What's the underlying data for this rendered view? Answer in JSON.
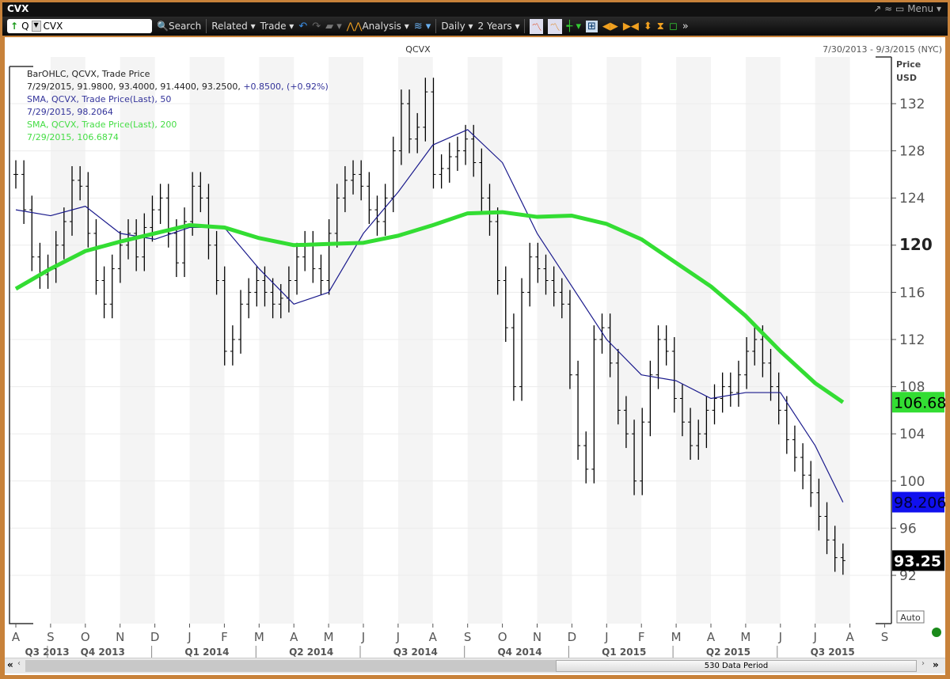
{
  "window": {
    "title": "CVX",
    "menu_label": "Menu ▾"
  },
  "toolbar": {
    "symbol_prefix": "Q",
    "symbol_value": "CVX",
    "search": "Search",
    "related": "Related ▾",
    "trade": "Trade ▾",
    "analysis": "Analysis ▾",
    "interval": "Daily ▾",
    "range": "2 Years ▾"
  },
  "chart_header": {
    "symbol": "QCVX",
    "date_range": "7/30/2013 - 9/3/2015 (NYC)",
    "axis_title_1": "Price",
    "axis_title_2": "USD",
    "auto_label": "Auto"
  },
  "legend": {
    "line1": "BarOHLC, QCVX, Trade Price",
    "line2_values": "7/29/2015, 91.9800, 93.4000, 91.4400, 93.2500, ",
    "line2_change": "+0.8500, (+0.92%)",
    "line3": "SMA, QCVX, Trade Price(Last),  50",
    "line4": "7/29/2015, 98.2064",
    "line5": "SMA, QCVX, Trade Price(Last),  200",
    "line6": "7/29/2015, 106.6874"
  },
  "scrollbar": {
    "label": "530 Data Period"
  },
  "colors": {
    "sma50": "#1a1a8c",
    "sma200": "#33dd33",
    "bars": "#000000",
    "frame": "#c8823a"
  },
  "chart_data": {
    "type": "ohlc",
    "title": "QCVX",
    "ylabel": "Price USD",
    "ylim": [
      88,
      136
    ],
    "yticks": [
      92,
      96,
      100,
      104,
      108,
      112,
      116,
      120,
      124,
      128,
      132
    ],
    "months": [
      "A",
      "S",
      "O",
      "N",
      "D",
      "J",
      "F",
      "M",
      "A",
      "M",
      "J",
      "J",
      "A",
      "S",
      "O",
      "N",
      "D",
      "J",
      "F",
      "M",
      "A",
      "M",
      "J",
      "J",
      "A",
      "S"
    ],
    "quarters": [
      "Q3 2013",
      "Q4 2013",
      "Q1 2014",
      "Q2 2014",
      "Q3 2014",
      "Q4 2014",
      "Q1 2015",
      "Q2 2015",
      "Q3 2015"
    ],
    "price_weekly_close_approx": [
      126,
      123,
      119,
      117.5,
      118,
      120,
      122,
      125.5,
      125,
      121,
      117,
      115,
      118,
      120,
      121,
      119,
      121.5,
      123,
      124,
      121,
      118.5,
      122,
      125,
      124,
      120,
      117,
      111,
      112,
      115,
      116,
      117,
      116,
      115,
      115.5,
      117,
      119,
      120,
      118,
      117,
      121,
      124,
      125.5,
      126,
      125,
      123,
      122,
      124,
      128,
      132,
      129,
      130,
      133,
      126,
      126.5,
      127.5,
      128,
      129,
      127,
      124,
      122,
      117,
      113,
      108,
      116,
      119,
      118,
      117,
      116,
      115,
      109,
      103,
      101,
      112,
      113,
      110,
      106,
      104,
      100,
      105,
      109,
      112,
      111,
      107,
      105,
      103,
      104,
      106,
      107,
      108,
      107.5,
      109,
      111,
      112,
      110,
      108,
      106,
      103.5,
      102,
      100.5,
      99,
      97,
      95,
      93.5,
      93.25
    ],
    "series": [
      {
        "name": "SMA 50",
        "values": [
          123,
          122.5,
          123.3,
          121,
          120.5,
          121.5,
          121.5,
          118,
          115,
          116,
          121,
          124.5,
          128.5,
          129.8,
          127,
          121,
          116.5,
          112,
          109,
          108.5,
          107,
          107.5,
          107.5,
          103,
          98.2
        ]
      },
      {
        "name": "SMA 200",
        "values": [
          116.3,
          118,
          119.5,
          120.3,
          121,
          121.7,
          121.5,
          120.6,
          120,
          120.1,
          120.2,
          120.8,
          121.7,
          122.7,
          122.8,
          122.4,
          122.5,
          121.8,
          120.5,
          118.5,
          116.5,
          114,
          111,
          108.3,
          106.68
        ]
      }
    ],
    "last_values": {
      "sma200": "106.68",
      "sma50": "98.206",
      "close": "93.25"
    }
  }
}
